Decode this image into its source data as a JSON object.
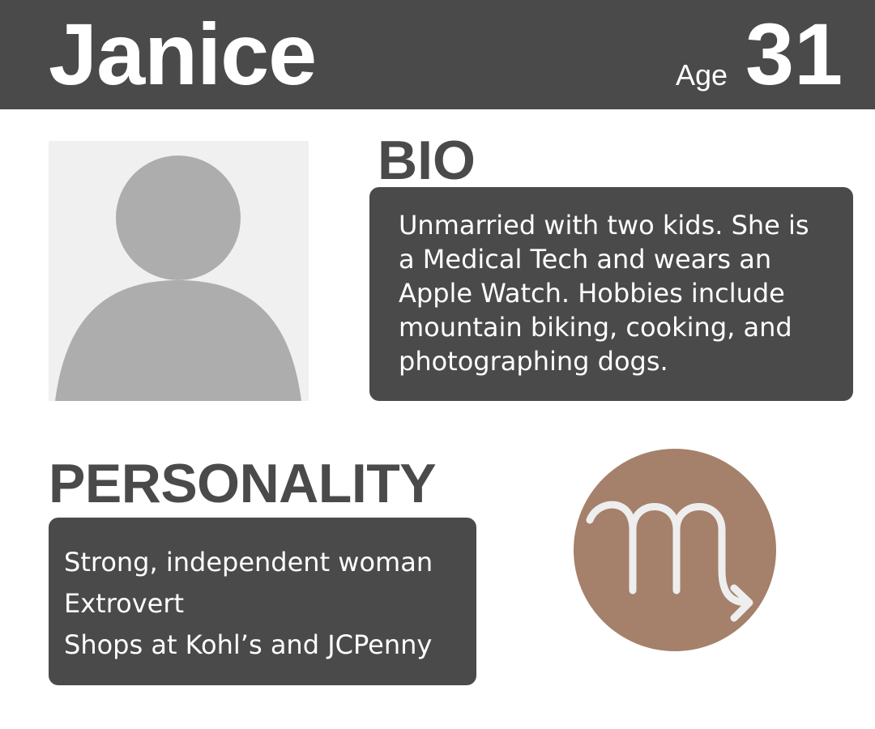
{
  "profile": {
    "name": "Janice",
    "age_label": "Age",
    "age_value": "31"
  },
  "avatar": {
    "icon": "person-silhouette-icon"
  },
  "bio": {
    "title": "BIO",
    "text": "Unmarried with two kids. She is a Medical Tech and wears an Apple Watch. Hobbies include mountain biking, cooking, and photographing dogs."
  },
  "personality": {
    "title": "PERSONALITY",
    "traits": [
      "Strong, independent woman",
      "Extrovert",
      "Shops at Kohl’s and JCPenny"
    ]
  },
  "zodiac": {
    "icon": "scorpio-icon",
    "color": "#a5806a"
  },
  "colors": {
    "header_bg": "#4a4a4a",
    "box_bg": "#4a4a4a",
    "avatar_bg": "#f0f0f0",
    "avatar_fg": "#adadad",
    "text_light": "#ffffff"
  }
}
